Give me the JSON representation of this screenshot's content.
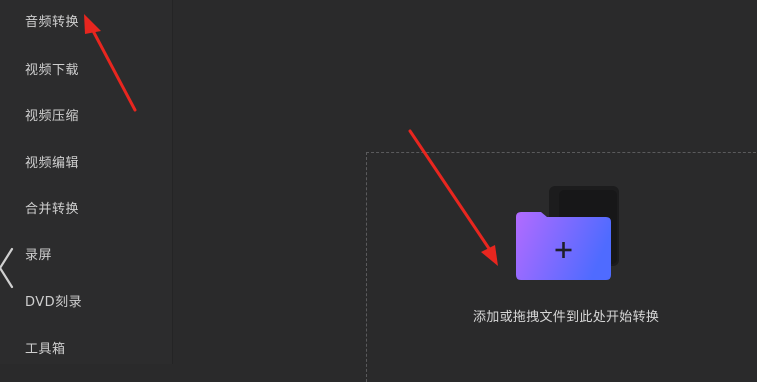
{
  "sidebar": {
    "items": [
      {
        "label": "音频转换"
      },
      {
        "label": "视频下载"
      },
      {
        "label": "视频压缩"
      },
      {
        "label": "视频编辑"
      },
      {
        "label": "合并转换"
      },
      {
        "label": "录屏"
      },
      {
        "label": "DVD刻录"
      },
      {
        "label": "工具箱"
      }
    ]
  },
  "dropzone": {
    "hint": "添加或拖拽文件到此处开始转换",
    "add_icon": "folder-plus-icon"
  },
  "colors": {
    "background": "#2a2a2b",
    "folder_gradient_start": "#b26bff",
    "folder_gradient_end": "#4f6bff",
    "annotation_arrow": "#e8261f"
  }
}
